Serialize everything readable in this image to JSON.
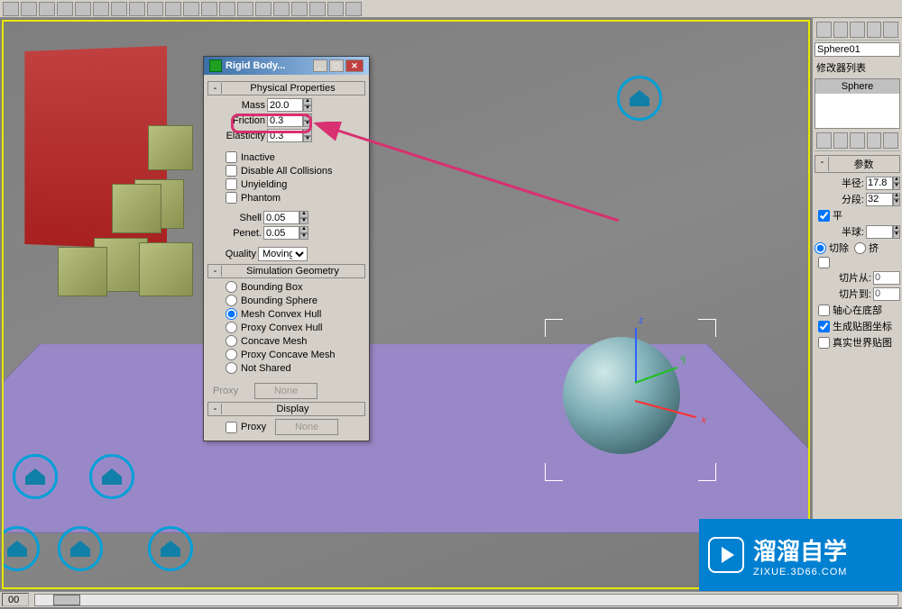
{
  "toolbar": {
    "icon_count": 30
  },
  "dialog": {
    "title": "Rigid Body...",
    "sections": {
      "physical": {
        "title": "Physical Properties",
        "mass_label": "Mass",
        "mass_value": "20.0",
        "friction_label": "Friction",
        "friction_value": "0.3",
        "elasticity_label": "Elasticity",
        "elasticity_value": "0.3",
        "inactive": "Inactive",
        "disable_collisions": "Disable All Collisions",
        "unyielding": "Unyielding",
        "phantom": "Phantom",
        "shell_label": "Shell",
        "shell_value": "0.05",
        "penet_label": "Penet.",
        "penet_value": "0.05",
        "quality_label": "Quality",
        "quality_value": "Moving"
      },
      "simulation": {
        "title": "Simulation Geometry",
        "options": [
          "Bounding Box",
          "Bounding Sphere",
          "Mesh Convex Hull",
          "Proxy Convex Hull",
          "Concave Mesh",
          "Proxy Concave Mesh",
          "Not Shared"
        ],
        "selected": 2,
        "proxy_label": "Proxy",
        "proxy_button": "None"
      },
      "display": {
        "title": "Display",
        "proxy_label": "Proxy",
        "proxy_button": "None"
      }
    }
  },
  "right_panel": {
    "object_name": "Sphere01",
    "modifier_label": "修改器列表",
    "modifier_item": "Sphere",
    "params_title": "参数",
    "radius_label": "半径:",
    "radius_value": "17.8",
    "segments_label": "分段:",
    "segments_value": "32",
    "smooth_label": "平",
    "hemisphere_label": "半球:",
    "chop_label": "切除",
    "squash_label": "挤",
    "slice_from_label": "切片从:",
    "slice_from_value": "0",
    "slice_to_label": "切片到:",
    "slice_to_value": "0",
    "base_pivot": "轴心在底部",
    "gen_uv": "生成贴图坐标",
    "real_world": "真实世界贴图"
  },
  "status": {
    "frame": "00"
  },
  "watermark": {
    "brand": "溜溜自学",
    "url": "ZIXUE.3D66.COM"
  }
}
